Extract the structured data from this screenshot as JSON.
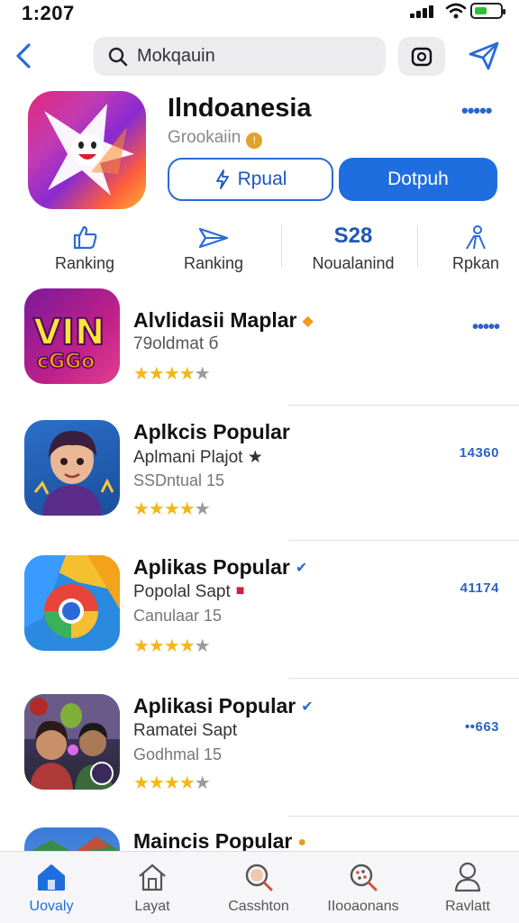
{
  "status_bar": {
    "time": "1:207"
  },
  "nav": {
    "search_text": "Mokqauin"
  },
  "app": {
    "title": "Ilndoanesia",
    "subtitle": "Grookaiin",
    "btn_secondary": "Rpual",
    "btn_primary": "Dotpuh",
    "more": "•••••"
  },
  "stats": [
    {
      "icon": "thumbs-up-icon",
      "value": "",
      "label": "Ranking"
    },
    {
      "icon": "paper-plane-icon",
      "value": "",
      "label": "Ranking"
    },
    {
      "icon": "",
      "value": "S28",
      "label": "Noualanind"
    },
    {
      "icon": "person-icon",
      "value": "",
      "label": "Rpkan"
    }
  ],
  "list": [
    {
      "icon": "vin-game-icon",
      "title": "Alvlidasiі Maplar",
      "line2": "79oldmat б",
      "line3": "",
      "right": "•••••",
      "rating": 4,
      "badge": "orange-shield-icon"
    },
    {
      "icon": "avatar-app-icon",
      "title": "Aplkcis Popular",
      "line2": "Aplmani Plajot ★",
      "line3": "SSDntual 15",
      "right": "14360",
      "rating": 4,
      "badge": ""
    },
    {
      "icon": "chrome-style-icon",
      "title": "Aplikas Popular",
      "line2": "Popolal Sapt",
      "line3": "Canulaar 15",
      "right": "41174",
      "rating": 4,
      "badge": "blue-check-icon"
    },
    {
      "icon": "photo-app-icon",
      "title": "Aplikasi Popular",
      "line2": "Ramatei Sapt",
      "line3": "Godhmal 15",
      "right": "••663",
      "rating": 4,
      "badge": "blue-check-icon"
    },
    {
      "icon": "landscape-app-icon",
      "title": "Maincis Popular",
      "line2": "",
      "line3": "",
      "right": "",
      "rating": 0,
      "badge": "gold-badge-icon"
    }
  ],
  "tabs": [
    {
      "label": "Uovaly",
      "icon": "home-icon",
      "active": true
    },
    {
      "label": "Layat",
      "icon": "house-outline-icon",
      "active": false
    },
    {
      "label": "Casshton",
      "icon": "search-icon",
      "active": false
    },
    {
      "label": "IIooaonans",
      "icon": "search-dots-icon",
      "active": false
    },
    {
      "label": "Ravlatt",
      "icon": "person-icon",
      "active": false
    }
  ],
  "colors": {
    "accent": "#1f6ee0",
    "star": "#f4b71a"
  }
}
